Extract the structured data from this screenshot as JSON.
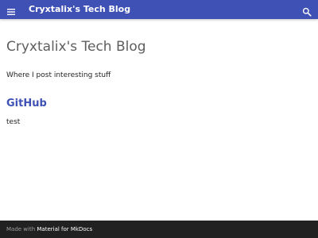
{
  "header": {
    "site_title": "Cryxtalix's Tech Blog",
    "menu_icon": "hamburger-menu-icon",
    "search_icon": "search-icon",
    "background_color": "#3f51b5"
  },
  "main": {
    "page_title": "Cryxtalix's Tech Blog",
    "tagline": "Where I post interesting stuff",
    "sections": [
      {
        "heading": "GitHub",
        "text": "test"
      }
    ],
    "heading_color": "#3f51b5"
  },
  "footer": {
    "made_with_text": "Made with",
    "made_with_link": "Material for MkDocs",
    "background_color": "#212121"
  }
}
